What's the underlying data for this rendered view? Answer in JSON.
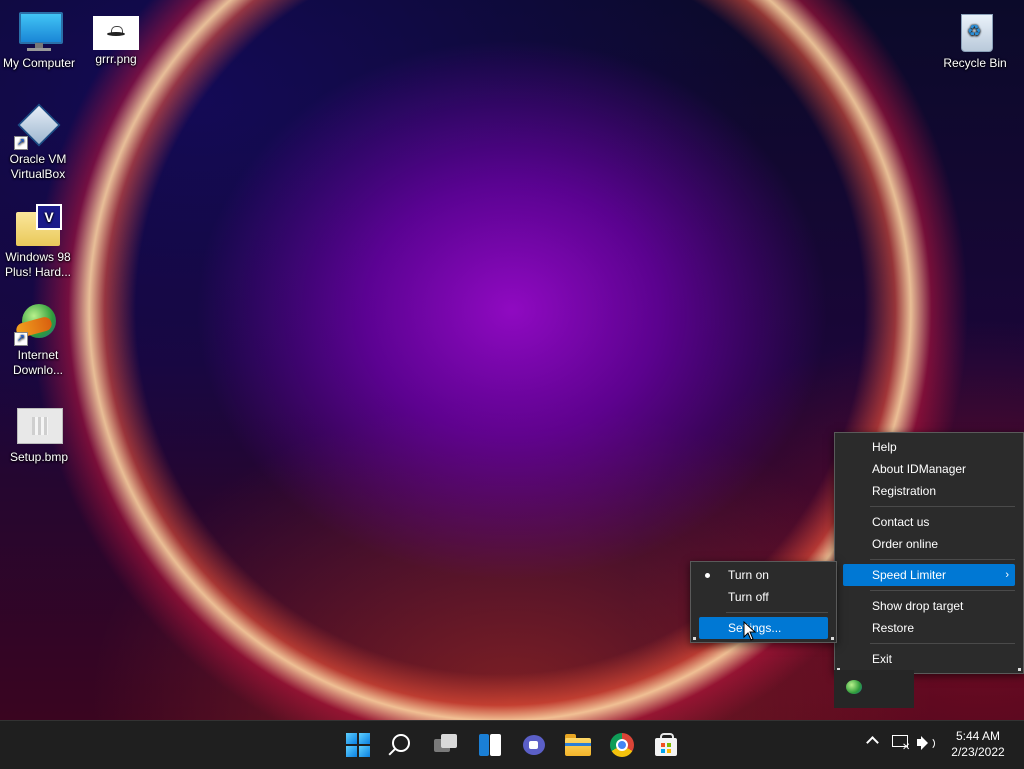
{
  "desktop": {
    "icons": [
      {
        "label": "My Computer",
        "icon": "computer-icon"
      },
      {
        "label": "grrr.png",
        "icon": "image-file-icon"
      },
      {
        "label": "Oracle VM VirtualBox",
        "icon": "virtualbox-icon"
      },
      {
        "label": "Windows 98 Plus! Hard...",
        "icon": "folder-icon"
      },
      {
        "label": "Internet Downlo...",
        "icon": "idm-icon"
      },
      {
        "label": "Setup.bmp",
        "icon": "bitmap-file-icon"
      },
      {
        "label": "Recycle Bin",
        "icon": "recycle-bin-icon"
      }
    ]
  },
  "idm_menu": {
    "items": [
      {
        "label": "Help"
      },
      {
        "label": "About IDManager"
      },
      {
        "label": "Registration"
      },
      {
        "label": "Contact us"
      },
      {
        "label": "Order online"
      },
      {
        "label": "Speed Limiter",
        "highlighted": true,
        "submenu": true
      },
      {
        "label": "Show drop target"
      },
      {
        "label": "Restore"
      },
      {
        "label": "Exit"
      }
    ]
  },
  "speed_submenu": {
    "items": [
      {
        "label": "Turn on",
        "checked": true
      },
      {
        "label": "Turn off"
      },
      {
        "label": "Settings...",
        "highlighted": true
      }
    ]
  },
  "taskbar": {
    "apps": [
      "start-icon",
      "search-icon",
      "task-view-icon",
      "widgets-icon",
      "teams-chat-icon",
      "file-explorer-icon",
      "chrome-icon",
      "store-icon"
    ],
    "tray": {
      "time": "5:44 AM",
      "date": "2/23/2022"
    }
  },
  "colors": {
    "menu_bg": "#2b2b2b",
    "highlight": "#0078d4",
    "taskbar_bg": "#1f1f1f"
  }
}
